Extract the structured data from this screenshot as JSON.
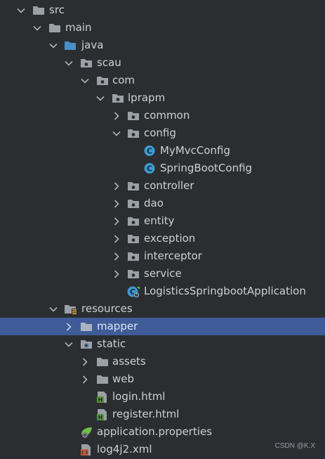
{
  "tree": {
    "items": [
      {
        "label": "src",
        "expanded": true,
        "icon": "folder-icon"
      },
      {
        "label": "main",
        "expanded": true,
        "icon": "folder-icon"
      },
      {
        "label": "java",
        "expanded": true,
        "icon": "source-root-folder-icon"
      },
      {
        "label": "scau",
        "expanded": true,
        "icon": "package-icon"
      },
      {
        "label": "com",
        "expanded": true,
        "icon": "package-icon"
      },
      {
        "label": "lprapm",
        "expanded": true,
        "icon": "package-icon"
      },
      {
        "label": "common",
        "expanded": false,
        "icon": "package-icon"
      },
      {
        "label": "config",
        "expanded": true,
        "icon": "package-icon"
      },
      {
        "label": "MyMvcConfig",
        "icon": "java-class-icon"
      },
      {
        "label": "SpringBootConfig",
        "icon": "java-class-icon"
      },
      {
        "label": "controller",
        "expanded": false,
        "icon": "package-icon"
      },
      {
        "label": "dao",
        "expanded": false,
        "icon": "package-icon"
      },
      {
        "label": "entity",
        "expanded": false,
        "icon": "package-icon"
      },
      {
        "label": "exception",
        "expanded": false,
        "icon": "package-icon"
      },
      {
        "label": "interceptor",
        "expanded": false,
        "icon": "package-icon"
      },
      {
        "label": "service",
        "expanded": false,
        "icon": "package-icon"
      },
      {
        "label": "LogisticsSpringbootApplication",
        "icon": "spring-boot-class-icon"
      },
      {
        "label": "resources",
        "expanded": true,
        "icon": "resources-root-folder-icon"
      },
      {
        "label": "mapper",
        "expanded": false,
        "selected": true,
        "icon": "folder-icon"
      },
      {
        "label": "static",
        "expanded": true,
        "icon": "web-resource-folder-icon"
      },
      {
        "label": "assets",
        "expanded": false,
        "icon": "folder-icon"
      },
      {
        "label": "web",
        "expanded": false,
        "icon": "folder-icon"
      },
      {
        "label": "login.html",
        "icon": "html-file-icon"
      },
      {
        "label": "register.html",
        "icon": "html-file-icon"
      },
      {
        "label": "application.properties",
        "icon": "spring-properties-icon"
      },
      {
        "label": "log4j2.xml",
        "icon": "xml-file-icon"
      }
    ]
  },
  "watermark": "CSDN @K.X",
  "colors": {
    "background": "#2b2d30",
    "selection": "#3f5c99",
    "folder": "#9aa0a6",
    "source_root": "#4a90c8",
    "java_class": "#3d9ad1",
    "html_green": "#5a9a3c",
    "text": "#cdd1d6"
  }
}
